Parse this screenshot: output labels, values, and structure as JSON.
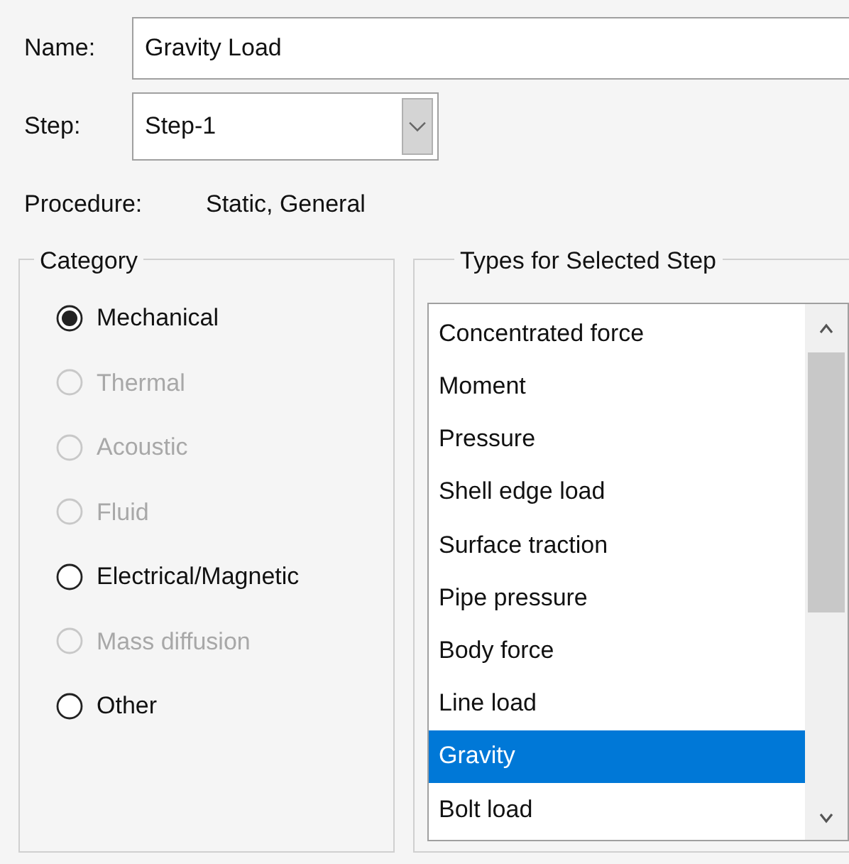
{
  "name_field": {
    "label": "Name:",
    "value": "Gravity Load"
  },
  "step_field": {
    "label": "Step:",
    "value": "Step-1"
  },
  "procedure": {
    "label": "Procedure:",
    "value": "Static, General"
  },
  "category": {
    "title": "Category",
    "options": [
      {
        "label": "Mechanical",
        "selected": true,
        "disabled": false
      },
      {
        "label": "Thermal",
        "selected": false,
        "disabled": true
      },
      {
        "label": "Acoustic",
        "selected": false,
        "disabled": true
      },
      {
        "label": "Fluid",
        "selected": false,
        "disabled": true
      },
      {
        "label": "Electrical/Magnetic",
        "selected": false,
        "disabled": false
      },
      {
        "label": "Mass diffusion",
        "selected": false,
        "disabled": true
      },
      {
        "label": "Other",
        "selected": false,
        "disabled": false
      }
    ]
  },
  "types": {
    "title": "Types for Selected Step",
    "items": [
      {
        "label": "Concentrated force",
        "selected": false
      },
      {
        "label": "Moment",
        "selected": false
      },
      {
        "label": "Pressure",
        "selected": false
      },
      {
        "label": "Shell edge load",
        "selected": false
      },
      {
        "label": "Surface traction",
        "selected": false
      },
      {
        "label": "Pipe pressure",
        "selected": false
      },
      {
        "label": "Body force",
        "selected": false
      },
      {
        "label": "Line load",
        "selected": false
      },
      {
        "label": "Gravity",
        "selected": true
      },
      {
        "label": "Bolt load",
        "selected": false
      }
    ]
  }
}
